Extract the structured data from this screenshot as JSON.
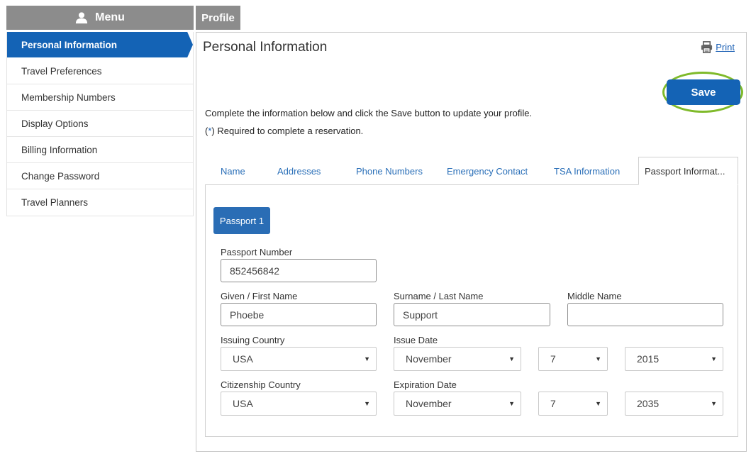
{
  "menu": {
    "title": "Menu",
    "icon": "user-icon"
  },
  "sidebar": {
    "items": [
      {
        "label": "Personal Information",
        "active": true
      },
      {
        "label": "Travel Preferences"
      },
      {
        "label": "Membership Numbers"
      },
      {
        "label": "Display Options"
      },
      {
        "label": "Billing Information"
      },
      {
        "label": "Change Password"
      },
      {
        "label": "Travel Planners"
      }
    ]
  },
  "profile_tab": {
    "label": "Profile"
  },
  "main": {
    "title": "Personal Information",
    "print_label": "Print",
    "save_label": "Save",
    "instructions": "Complete the information below and click the Save button to update your profile.",
    "required_prefix": "(",
    "required_star": "*",
    "required_suffix": ") Required to complete a reservation."
  },
  "tabs": [
    {
      "label": "Name"
    },
    {
      "label": "Addresses"
    },
    {
      "label": "Phone Numbers"
    },
    {
      "label": "Emergency Contact"
    },
    {
      "label": "TSA Information"
    },
    {
      "label": "Passport Informat...",
      "active": true
    }
  ],
  "passport": {
    "button_label": "Passport 1",
    "number_label": "Passport Number",
    "number_value": "852456842",
    "given_label": "Given / First Name",
    "given_value": "Phoebe",
    "surname_label": "Surname / Last Name",
    "surname_value": "Support",
    "middle_label": "Middle Name",
    "middle_value": "",
    "issuing_country_label": "Issuing Country",
    "issuing_country_value": "USA",
    "issue_date_label": "Issue Date",
    "issue_month": "November",
    "issue_day": "7",
    "issue_year": "2015",
    "citizenship_label": "Citizenship Country",
    "citizenship_value": "USA",
    "expiration_label": "Expiration Date",
    "exp_month": "November",
    "exp_day": "7",
    "exp_year": "2035"
  },
  "colors": {
    "primary": "#1463b5",
    "menu_gray": "#8c8c8c",
    "link": "#2a6fb8",
    "highlight_ring": "#7fba2a"
  }
}
